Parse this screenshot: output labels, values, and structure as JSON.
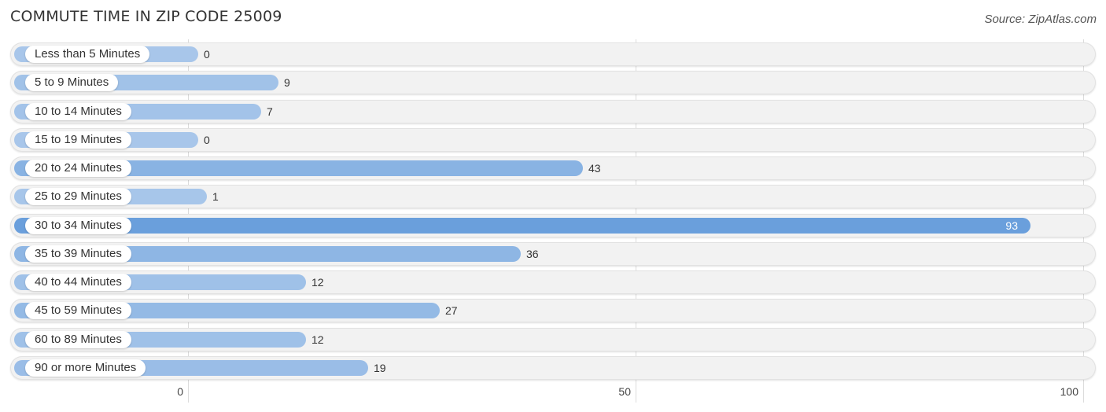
{
  "header": {
    "title": "COMMUTE TIME IN ZIP CODE 25009",
    "source": "Source: ZipAtlas.com"
  },
  "colors": {
    "bar_light": "#a8c6ea",
    "bar_mid": "#86b1e2",
    "bar_highlight": "#6a9fdc",
    "row_bg": "#f2f2f2"
  },
  "chart_data": {
    "type": "bar",
    "orientation": "horizontal",
    "title": "COMMUTE TIME IN ZIP CODE 25009",
    "xlabel": "",
    "ylabel": "",
    "xlim": [
      0,
      100
    ],
    "x_ticks": [
      "0",
      "50",
      "100"
    ],
    "grid": true,
    "categories": [
      "Less than 5 Minutes",
      "5 to 9 Minutes",
      "10 to 14 Minutes",
      "15 to 19 Minutes",
      "20 to 24 Minutes",
      "25 to 29 Minutes",
      "30 to 34 Minutes",
      "35 to 39 Minutes",
      "40 to 44 Minutes",
      "45 to 59 Minutes",
      "60 to 89 Minutes",
      "90 or more Minutes"
    ],
    "values": [
      0,
      9,
      7,
      0,
      43,
      1,
      93,
      36,
      12,
      27,
      12,
      19
    ],
    "value_labels": [
      "0",
      "9",
      "7",
      "0",
      "43",
      "1",
      "93",
      "36",
      "12",
      "27",
      "12",
      "19"
    ],
    "highlight_index": 6
  }
}
